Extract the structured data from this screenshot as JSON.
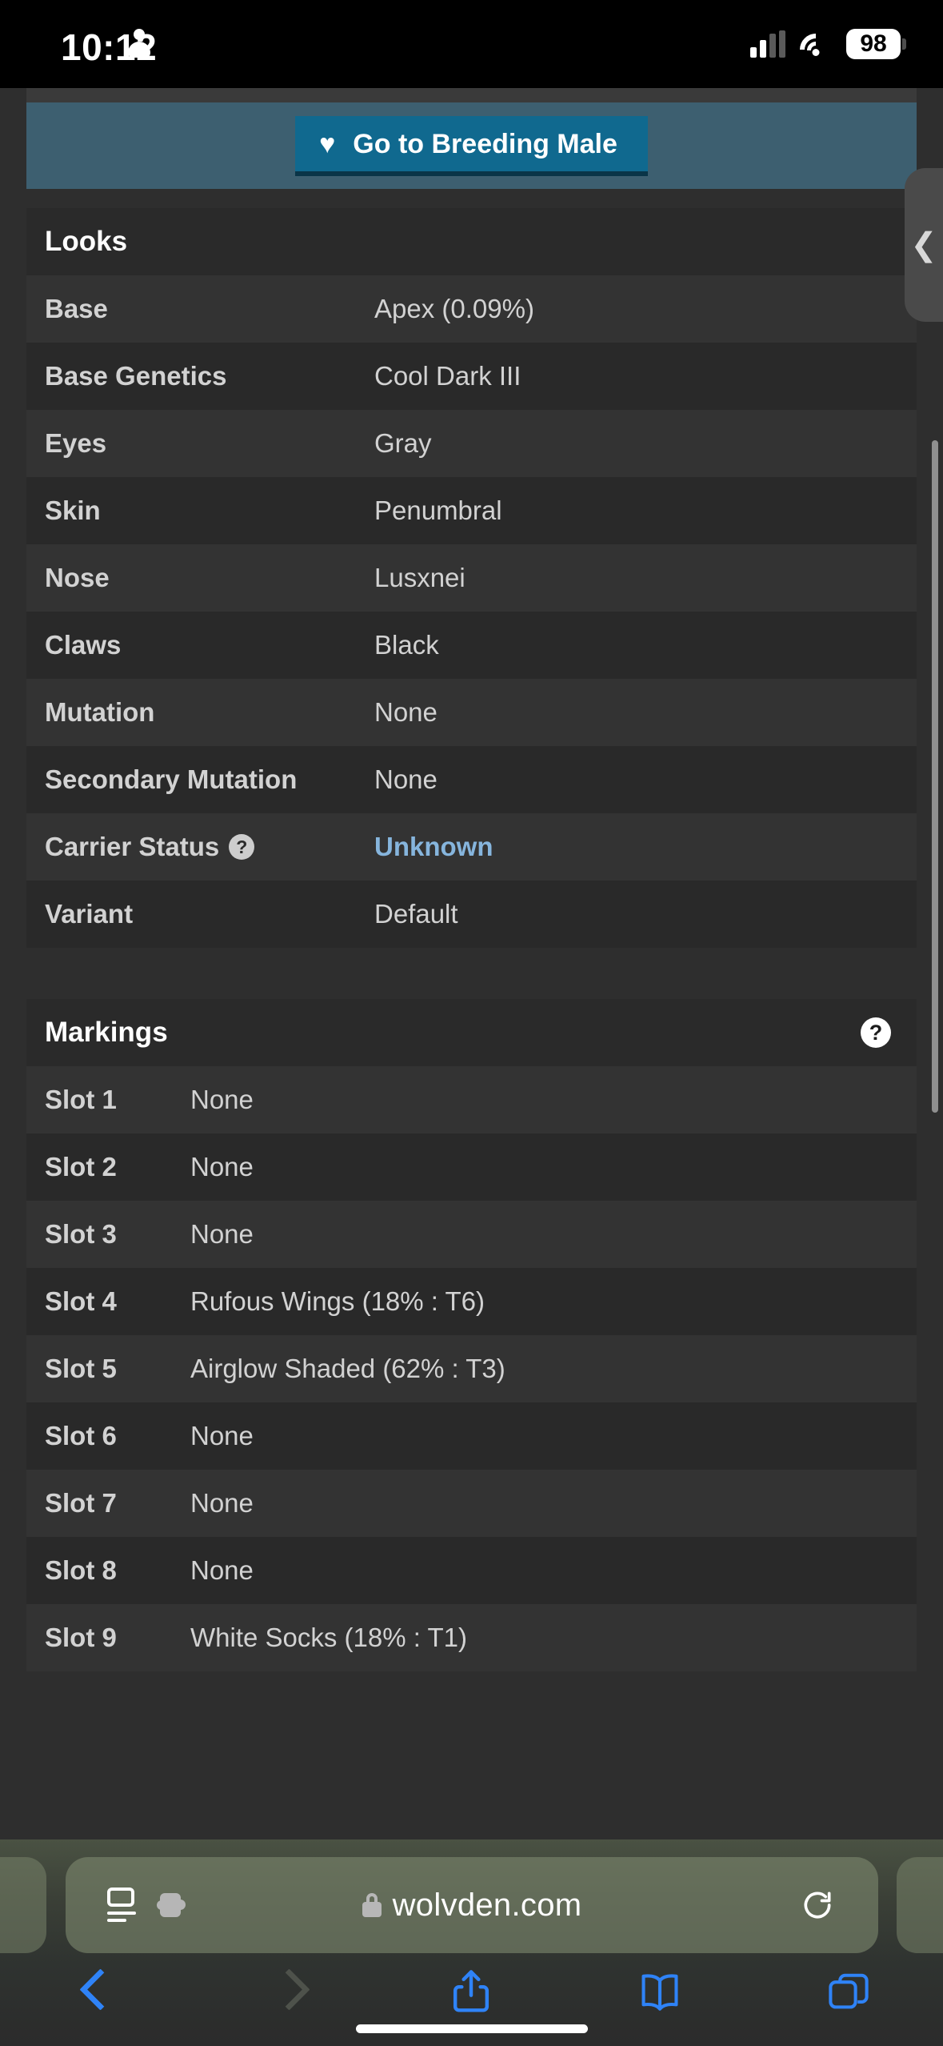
{
  "status_bar": {
    "time": "10:12",
    "person_icon": "person-icon",
    "signal_icon": "cellular-signal-icon",
    "wifi_icon": "wifi-icon",
    "battery_level": "98"
  },
  "breeding_banner": {
    "button_label": "Go to Breeding Male",
    "button_icon": "heart-icon",
    "banner_color": "#3d5f70",
    "button_color": "#10698f"
  },
  "looks": {
    "title": "Looks",
    "rows": [
      {
        "label": "Base",
        "value": "Apex (0.09%)",
        "link": false,
        "help": false
      },
      {
        "label": "Base Genetics",
        "value": "Cool Dark III",
        "link": false,
        "help": false
      },
      {
        "label": "Eyes",
        "value": "Gray",
        "link": false,
        "help": false
      },
      {
        "label": "Skin",
        "value": "Penumbral",
        "link": false,
        "help": false
      },
      {
        "label": "Nose",
        "value": "Lusxnei",
        "link": false,
        "help": false
      },
      {
        "label": "Claws",
        "value": "Black",
        "link": false,
        "help": false
      },
      {
        "label": "Mutation",
        "value": "None",
        "link": false,
        "help": false
      },
      {
        "label": "Secondary Mutation",
        "value": "None",
        "link": false,
        "help": false
      },
      {
        "label": "Carrier Status",
        "value": "Unknown",
        "link": true,
        "help": true
      },
      {
        "label": "Variant",
        "value": "Default",
        "link": false,
        "help": false
      }
    ]
  },
  "markings": {
    "title": "Markings",
    "help_icon": "help-circle-icon",
    "rows": [
      {
        "label": "Slot 1",
        "value": "None"
      },
      {
        "label": "Slot 2",
        "value": "None"
      },
      {
        "label": "Slot 3",
        "value": "None"
      },
      {
        "label": "Slot 4",
        "value": "Rufous Wings (18% : T6)"
      },
      {
        "label": "Slot 5",
        "value": "Airglow Shaded (62% : T3)"
      },
      {
        "label": "Slot 6",
        "value": "None"
      },
      {
        "label": "Slot 7",
        "value": "None"
      },
      {
        "label": "Slot 8",
        "value": "None"
      },
      {
        "label": "Slot 9",
        "value": "White Socks (18% : T1)"
      }
    ]
  },
  "edge_tab": {
    "glyph": "❮",
    "icon": "chevron-left-icon"
  },
  "browser": {
    "url": "wolvden.com",
    "lock_icon": "lock-icon",
    "reader_icon": "page-settings-icon",
    "extensions_icon": "puzzle-piece-icon",
    "reload_icon": "reload-icon",
    "toolbar": {
      "back_icon": "back-chevron-icon",
      "forward_icon": "forward-chevron-icon",
      "share_icon": "share-icon",
      "bookmarks_icon": "book-icon",
      "tabs_icon": "tabs-icon"
    }
  }
}
